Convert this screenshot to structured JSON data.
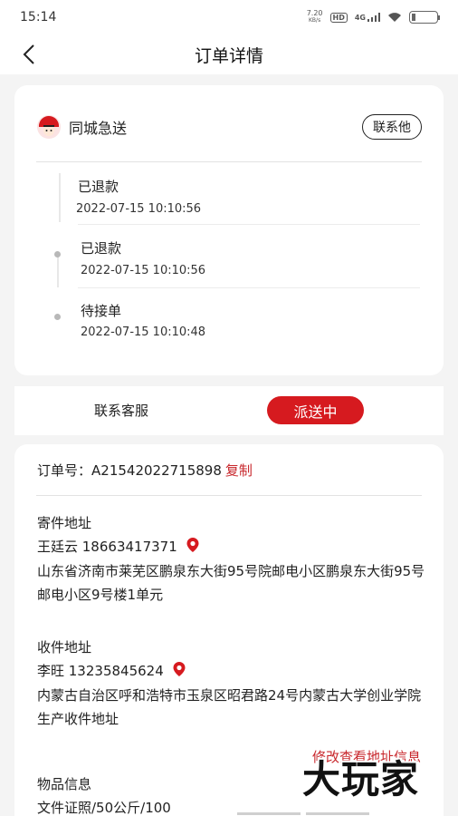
{
  "status_bar": {
    "time": "15:14",
    "net_speed_value": "7.20",
    "net_speed_unit": "KB/s",
    "hd_badge": "HD",
    "network": "4G"
  },
  "header": {
    "title": "订单详情"
  },
  "courier": {
    "name": "同城急送",
    "contact_button": "联系他",
    "events": [
      {
        "status": "已退款",
        "time": "2022-07-15 10:10:56"
      },
      {
        "status": "已退款",
        "time": "2022-07-15 10:10:56"
      },
      {
        "status": "待接单",
        "time": "2022-07-15 10:10:48"
      }
    ]
  },
  "actions": {
    "customer_service": "联系客服",
    "status_button": "派送中"
  },
  "order": {
    "number_label": "订单号：",
    "number": "A21542022715898",
    "copy_label": "复制",
    "sender": {
      "title": "寄件地址",
      "name_phone": "王廷云 18663417371",
      "address": "山东省济南市莱芜区鹏泉东大街95号院邮电小区鹏泉东大街95号邮电小区9号楼1单元"
    },
    "receiver": {
      "title": "收件地址",
      "name_phone": "李旺 13235845624",
      "address": "内蒙古自治区呼和浩特市玉泉区昭君路24号内蒙古大学创业学院生产收件地址"
    },
    "edit_link": "修改查看地址信息",
    "item_title": "物品信息",
    "item_desc": "文件证照/50公斤/100"
  },
  "watermark": "大玩家",
  "colors": {
    "accent": "#d61a1f",
    "link": "#c8272c"
  }
}
